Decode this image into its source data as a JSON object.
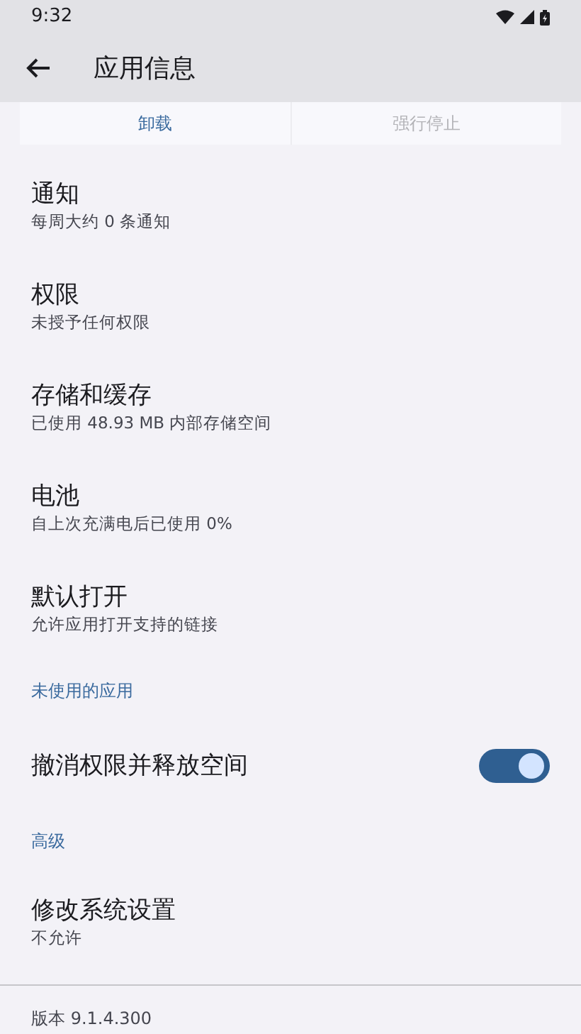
{
  "status_bar": {
    "time": "9:32"
  },
  "app_bar": {
    "title": "应用信息"
  },
  "action_buttons": [
    {
      "label": "卸载",
      "disabled": false
    },
    {
      "label": "强行停止",
      "disabled": true
    }
  ],
  "settings": [
    {
      "kind": "item",
      "title": "通知",
      "subtitle": "每周大约 0 条通知"
    },
    {
      "kind": "item",
      "title": "权限",
      "subtitle": "未授予任何权限"
    },
    {
      "kind": "item",
      "title": "存储和缓存",
      "subtitle": "已使用 48.93 MB 内部存储空间"
    },
    {
      "kind": "item",
      "title": "电池",
      "subtitle": "自上次充满电后已使用 0%"
    },
    {
      "kind": "item",
      "title": "默认打开",
      "subtitle": "允许应用打开支持的链接"
    },
    {
      "kind": "header",
      "title": "未使用的应用"
    },
    {
      "kind": "switch",
      "title": "撤消权限并释放空间",
      "on": true
    },
    {
      "kind": "header",
      "title": "高级"
    },
    {
      "kind": "item",
      "title": "修改系统设置",
      "subtitle": "不允许"
    }
  ],
  "footer": {
    "version": "版本 9.1.4.300"
  }
}
